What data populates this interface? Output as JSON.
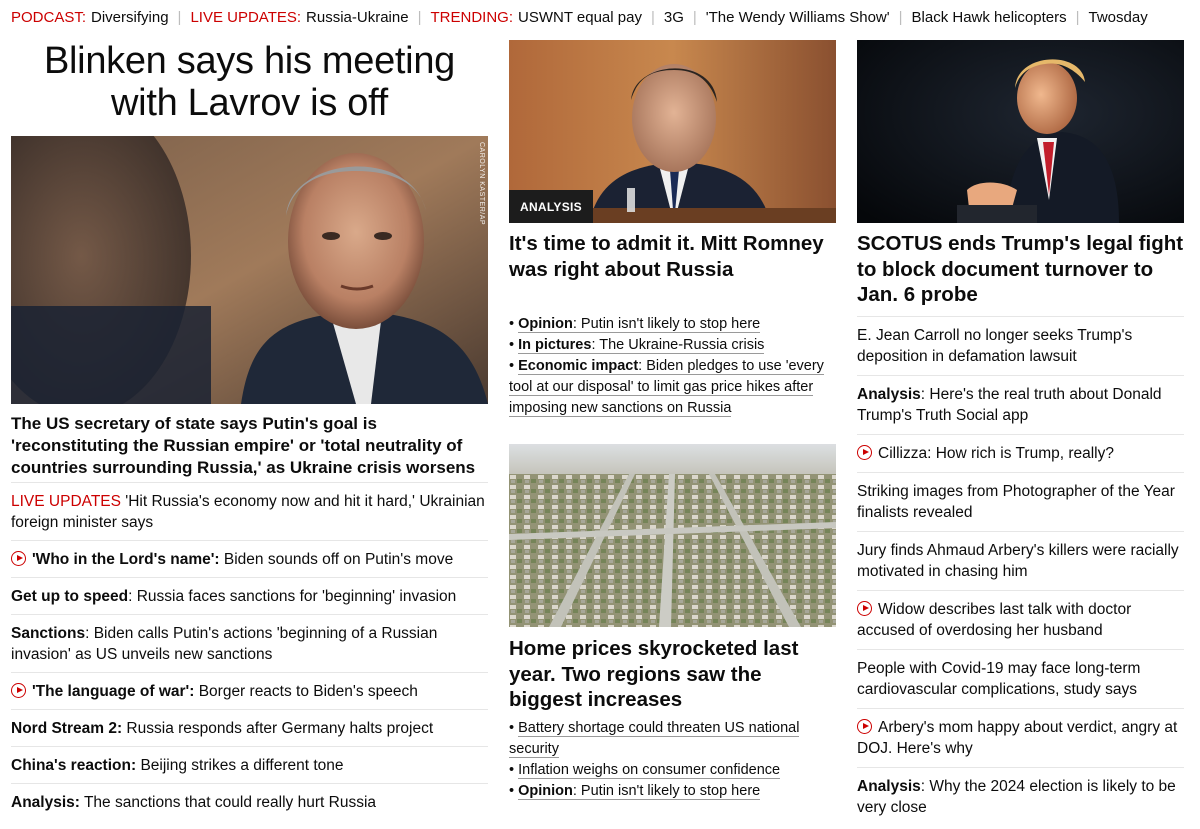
{
  "trending": [
    {
      "label": "PODCAST:",
      "text": "Diversifying"
    },
    {
      "label": "LIVE UPDATES:",
      "text": "Russia-Ukraine"
    },
    {
      "label": "TRENDING:",
      "text": "USWNT equal pay"
    },
    {
      "label": "",
      "text": "3G"
    },
    {
      "label": "",
      "text": "'The Wendy Williams Show'"
    },
    {
      "label": "",
      "text": "Black Hawk helicopters"
    },
    {
      "label": "",
      "text": "Twosday"
    }
  ],
  "left": {
    "headline": "Blinken says his meeting with Lavrov is off",
    "photo_credit": "CAROLYN KASTER/AP",
    "caption": "The US secretary of state says Putin's goal is 'reconstituting the Russian empire' or 'total neutrality of countries surrounding Russia,' as Ukraine crisis worsens",
    "items": [
      {
        "prefix": "LIVE UPDATES",
        "bold": "",
        "text": " 'Hit Russia's economy now and hit it hard,' Ukrainian foreign minister says"
      },
      {
        "prefix": "",
        "bold": "'Who in the Lord's name':",
        "text": " Biden sounds off on Putin's move"
      },
      {
        "prefix": "",
        "bold": "Get up to speed",
        "text": ": Russia faces sanctions for 'beginning' invasion"
      },
      {
        "prefix": "",
        "bold": "Sanctions",
        "text": ": Biden calls Putin's actions 'beginning of a Russian invasion' as US unveils new sanctions"
      },
      {
        "prefix": "",
        "bold": "'The language of war':",
        "text": " Borger reacts to Biden's speech"
      },
      {
        "prefix": "",
        "bold": "Nord Stream 2:",
        "text": " Russia responds after Germany halts project"
      },
      {
        "prefix": "",
        "bold": "China's reaction:",
        "text": " Beijing strikes a different tone"
      },
      {
        "prefix": "",
        "bold": "Analysis:",
        "text": " The sanctions that could really hurt Russia"
      }
    ]
  },
  "mid": {
    "card1": {
      "badge": "ANALYSIS",
      "title": "It's time to admit it. Mitt Romney was right about Russia",
      "bullets": [
        {
          "bold": "Opinion",
          "text": ": Putin isn't likely to stop here"
        },
        {
          "bold": "In pictures",
          "text": ": The Ukraine-Russia crisis"
        },
        {
          "bold": "Economic impact",
          "text": ": Biden pledges to use 'every tool at our disposal' to limit gas price hikes after imposing new sanctions on Russia"
        }
      ]
    },
    "card2": {
      "title": "Home prices skyrocketed last year. Two regions saw the biggest increases",
      "bullets": [
        {
          "bold": "",
          "text": "Battery shortage could threaten US national security"
        },
        {
          "bold": "",
          "text": "Inflation weighs on consumer confidence"
        },
        {
          "bold": "Opinion",
          "text": ": Putin isn't likely to stop here"
        }
      ]
    }
  },
  "right": {
    "title": "SCOTUS ends Trump's legal fight to block document turnover to Jan. 6 probe",
    "items": [
      {
        "bold": "",
        "text": "E. Jean Carroll no longer seeks Trump's deposition in defamation lawsuit"
      },
      {
        "bold": "Analysis",
        "text": ": Here's the real truth about Donald Trump's Truth Social app"
      },
      {
        "bold": "",
        "text": "Cillizza: How rich is Trump, really?"
      },
      {
        "bold": "",
        "text": "Striking images from Photographer of the Year finalists revealed"
      },
      {
        "bold": "",
        "text": "Jury finds Ahmaud Arbery's killers were racially motivated in chasing him"
      },
      {
        "bold": "",
        "text": "Widow describes last talk with doctor accused of overdosing her husband"
      },
      {
        "bold": "",
        "text": "People with Covid-19 may face long-term cardiovascular complications, study says"
      },
      {
        "bold": "",
        "text": "Arbery's mom happy about verdict, angry at DOJ. Here's why"
      },
      {
        "bold": "Analysis",
        "text": ": Why the 2024 election is likely to be very close"
      }
    ]
  },
  "colors": {
    "accent": "#cc0000",
    "text": "#0c0c0c",
    "divider": "#e6e6e6"
  }
}
